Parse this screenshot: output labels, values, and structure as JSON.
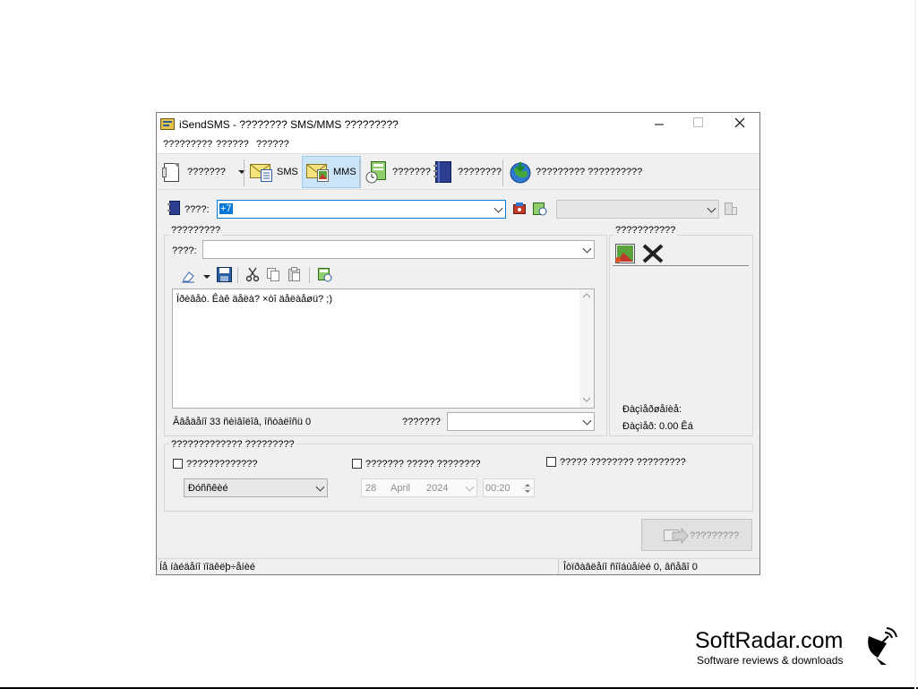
{
  "window": {
    "title": "iSendSMS - ???????? SMS/MMS ?????????",
    "controls": {
      "minimize": "—",
      "maximize": "☐",
      "close": "✕"
    }
  },
  "menu": [
    "?????????",
    "??????",
    "??????"
  ],
  "toolbar": {
    "new_label": "???????",
    "sms_label": "SMS",
    "mms_label": "MMS",
    "journal_label": "???????",
    "contacts_label": "????????",
    "download_label": "????????? ??????????"
  },
  "recipient": {
    "label": "????:",
    "value": "+7"
  },
  "message_group": {
    "legend": "?????????",
    "subject_label": "????:",
    "body_text": "Ïðèâåò. Êàê äåëà? ×òî äåëàåøü? ;)",
    "counter_text": "Ââåäåíî 33 ñèìâîëîâ, îñòàëîñü 0",
    "sender_label": "???????"
  },
  "attachments_group": {
    "legend": "???????????",
    "size_label": "Ðàçìåðøåíèå:",
    "cost_label": "Ðàçìåð: 0.00 Êá"
  },
  "options_group": {
    "legend": "????????????? ?????????",
    "option1_label": "?????????????",
    "option2_label": "??????? ????? ????????",
    "option3_label": "????? ???????? ?????????",
    "mode_value": "Ðóññêèé",
    "date_day": "28",
    "date_month": "April",
    "date_year": "2024",
    "time_value": "00:20"
  },
  "send_button": "?????????",
  "status": {
    "left": "Íå íàéäåíî ïîäêëþ÷åíèé",
    "right": "Îòïðàâëåíî ñîîáùåíèé 0, âñåãî 0"
  },
  "watermark": {
    "brand": "SoftRadar.com",
    "tagline": "Software reviews & downloads"
  },
  "colors": {
    "accent": "#0078d7",
    "selected_button_bg": "#cce4f7",
    "selected_button_border": "#99c9ef"
  }
}
